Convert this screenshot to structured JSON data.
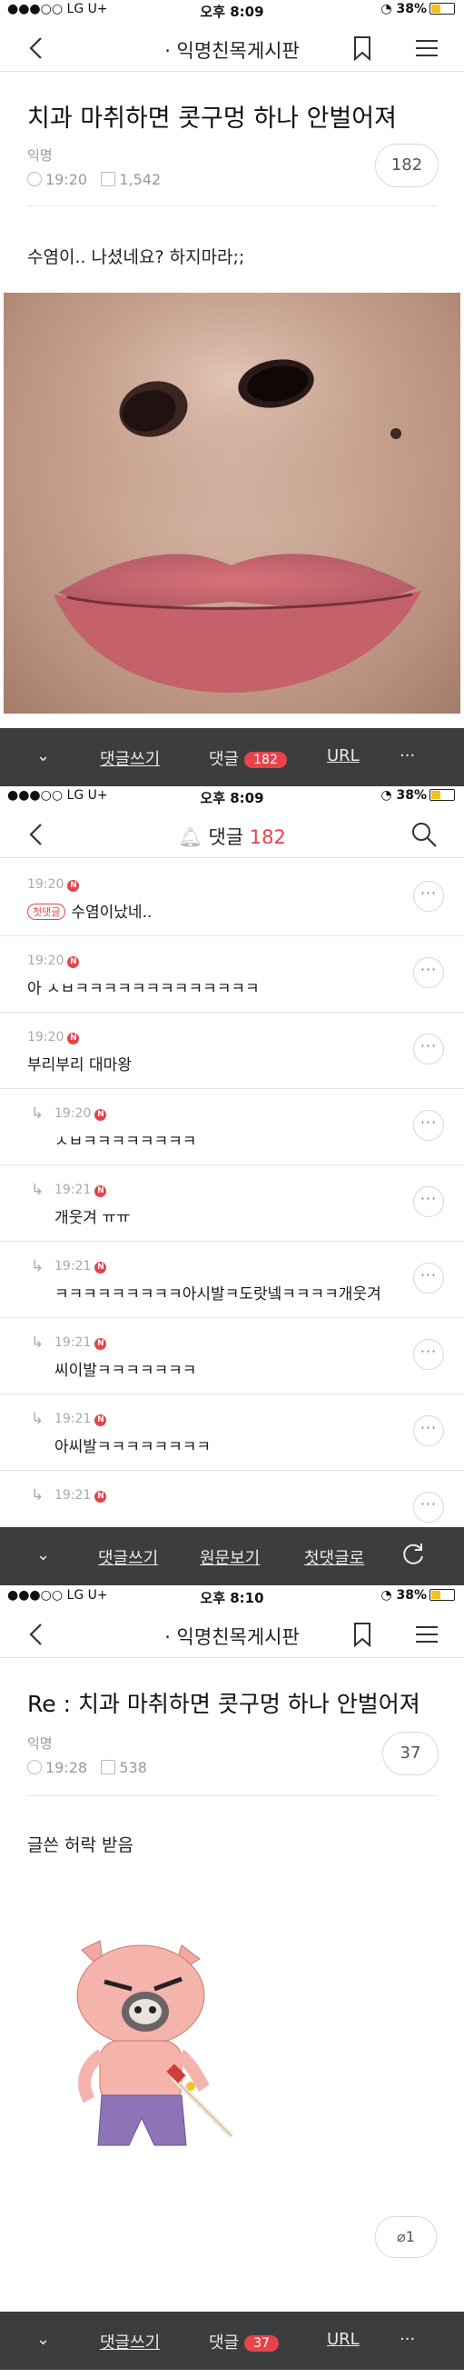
{
  "status": {
    "carrier": "●●●○○ LG U+",
    "battery": "38%"
  },
  "screen1": {
    "time": "오후 8:09",
    "board_title": "· 익명친목게시판",
    "post_title": "치과 마취하면 콧구멍 하나 안벌어져",
    "author": "익명",
    "post_time": "19:20",
    "views": "1,542",
    "comment_count": "182",
    "body_text": "수염이.. 나셨네요? 하지마라;;",
    "bottom": {
      "write": "댓글쓰기",
      "comments": "댓글",
      "comments_count": "182",
      "url": "URL",
      "more": "···"
    }
  },
  "screen2": {
    "time": "오후 8:09",
    "title_label": "댓글",
    "title_count": "182",
    "tag": "첫댓글",
    "comments": [
      {
        "time": "19:20",
        "text": "수염이났네.."
      },
      {
        "time": "19:20",
        "text": "아 ㅅㅂㅋㅋㅋㅋㅋㅋㅋㅋㅋㅋㅋㅋㅋ"
      },
      {
        "time": "19:20",
        "text": "부리부리 대마왕"
      },
      {
        "time": "19:20",
        "text": "ㅅㅂㅋㅋㅋㅋㅋㅋㅋㅋ"
      },
      {
        "time": "19:21",
        "text": "개웃겨 ㅠㅠ"
      },
      {
        "time": "19:21",
        "text": "ㅋㅋㅋㅋㅋㅋㅋㅋㅋ아시발ㅋ도랏넼ㅋㅋㅋㅋ개웃겨"
      },
      {
        "time": "19:21",
        "text": "씨이발ㅋㅋㅋㅋㅋㅋㅋ"
      },
      {
        "time": "19:21",
        "text": "아씨발ㅋㅋㅋㅋㅋㅋㅋㅋ"
      },
      {
        "time": "19:21",
        "text": ""
      }
    ],
    "bottom": {
      "write": "댓글쓰기",
      "original": "원문보기",
      "first": "첫댓글로"
    }
  },
  "screen3": {
    "time": "오후 8:10",
    "board_title": "· 익명친목게시판",
    "post_title": "Re : 치과 마취하면 콧구멍 하나 안벌어져",
    "author": "익명",
    "post_time": "19:28",
    "views": "538",
    "comment_count": "37",
    "body_text": "글쓴 허락 받음",
    "attach_count": "1",
    "bottom": {
      "write": "댓글쓰기",
      "comments": "댓글",
      "comments_count": "37",
      "url": "URL",
      "more": "···"
    }
  },
  "colors": {
    "accent": "#e8424a",
    "bar": "#3c3d3f",
    "battery": "#f3c21b"
  }
}
